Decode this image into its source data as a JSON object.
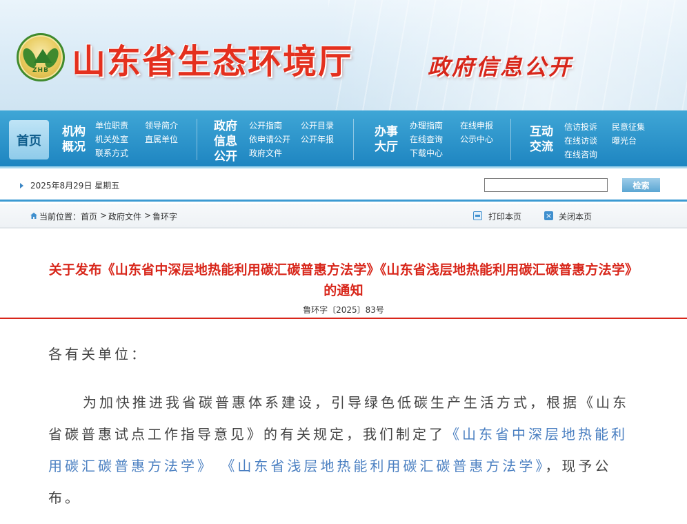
{
  "header": {
    "logo_text": "ZHB",
    "site_title": "山东省生态环境厅",
    "sub_title": "政府信息公开"
  },
  "nav": {
    "home": "首页",
    "groups": [
      {
        "title_line1": "机构",
        "title_line2": "概况",
        "links": [
          "单位职责",
          "领导简介",
          "机关处室",
          "直属单位",
          "联系方式"
        ]
      },
      {
        "title_line1": "政府",
        "title_line2": "信息",
        "title_line3": "公开",
        "links": [
          "公开指南",
          "公开目录",
          "依申请公开",
          "公开年报",
          "政府文件"
        ]
      },
      {
        "title_line1": "办事",
        "title_line2": "大厅",
        "links": [
          "办理指南",
          "在线申报",
          "在线查询",
          "公示中心",
          "下载中心"
        ]
      },
      {
        "title_line1": "互动",
        "title_line2": "交流",
        "links": [
          "信访投诉",
          "民意征集",
          "在线访谈",
          "曝光台",
          "在线咨询"
        ]
      }
    ]
  },
  "datebar": {
    "date": "2025年8月29日 星期五",
    "search_placeholder": "",
    "search_button": "检索"
  },
  "breadcrumb": {
    "prefix": "当前位置：",
    "items": [
      "首页",
      "政府文件",
      "鲁环字"
    ],
    "separator": ">",
    "print": "打印本页",
    "close": "关闭本页"
  },
  "article": {
    "title_line1": "关于发布《山东省中深层地热能利用碳汇碳普惠方法学》《山东省浅层地热能利用碳汇碳普惠方法学》",
    "title_line2": "的通知",
    "doc_no": "鲁环字〔2025〕83号",
    "salutation": "各有关单位：",
    "para_before": "为加快推进我省碳普惠体系建设，引导绿色低碳生产生活方式，根据《山东省碳普惠试点工作指导意见》的有关规定，我们制定了",
    "link1": "《山东省中深层地热能利用碳汇碳普惠方法学》",
    "link_gap": " ",
    "link2": "《山东省浅层地热能利用碳汇碳普惠方法学》",
    "para_after": "，现予公布。"
  },
  "colors": {
    "accent_red": "#d8261a",
    "nav_blue": "#1d84c0",
    "link_blue": "#4a7fc1"
  }
}
